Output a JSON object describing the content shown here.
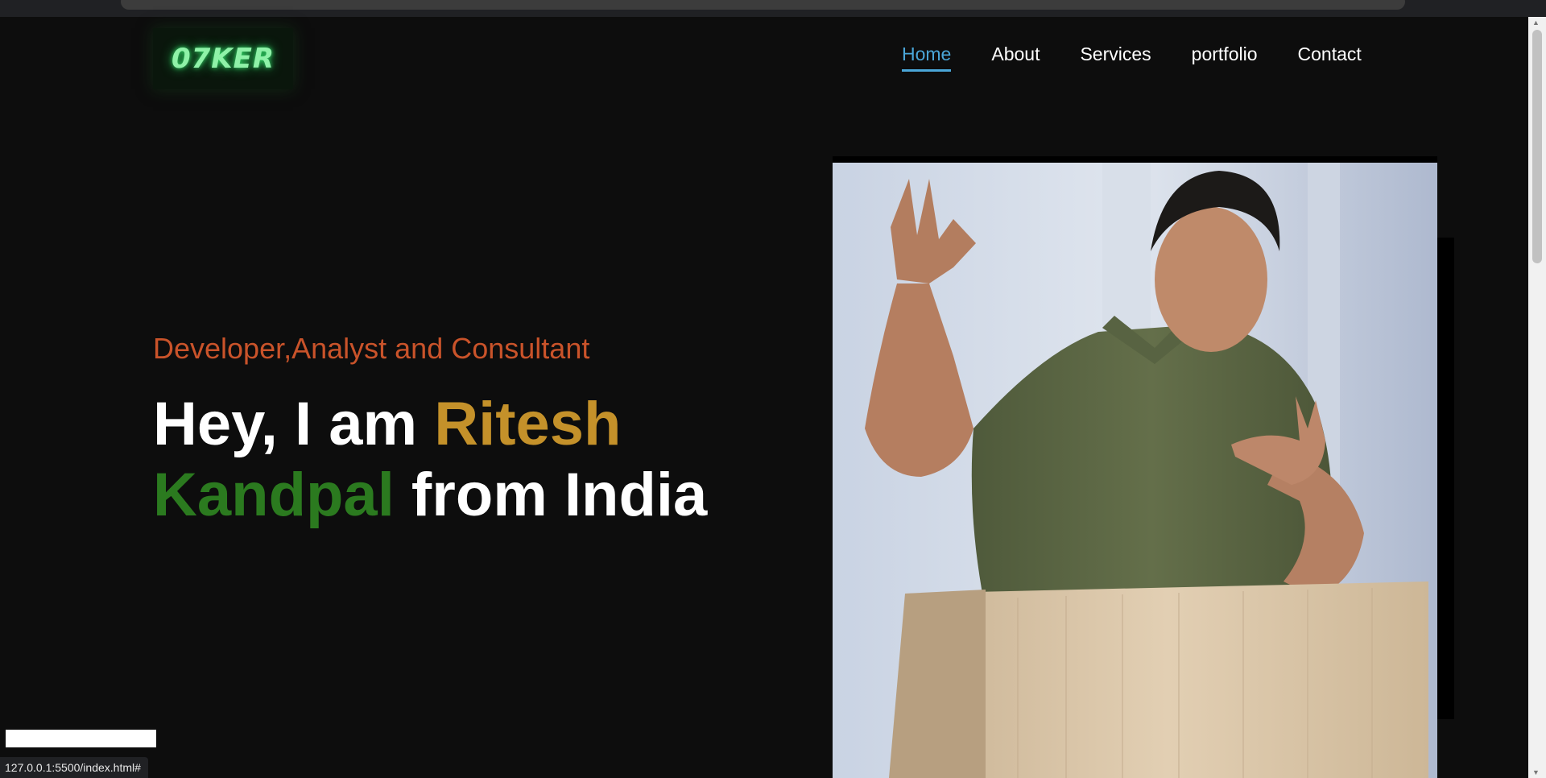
{
  "logo": {
    "text": "07KER"
  },
  "nav": {
    "items": [
      {
        "label": "Home",
        "active": true
      },
      {
        "label": "About",
        "active": false
      },
      {
        "label": "Services",
        "active": false
      },
      {
        "label": "portfolio",
        "active": false
      },
      {
        "label": "Contact",
        "active": false
      }
    ]
  },
  "hero": {
    "tagline": "Developer,Analyst and Consultant",
    "greeting": "Hey, I am ",
    "name_first": "Ritesh",
    "name_last": "Kandpal",
    "suffix": " from India"
  },
  "status_bar": {
    "url": "127.0.0.1:5500/index.html#"
  },
  "colors": {
    "background": "#0d0d0d",
    "nav_active": "#4aa6d8",
    "tagline": "#c9532a",
    "name_first": "#c4912a",
    "name_last": "#2b7a1f",
    "logo_glow": "#35d96a"
  }
}
